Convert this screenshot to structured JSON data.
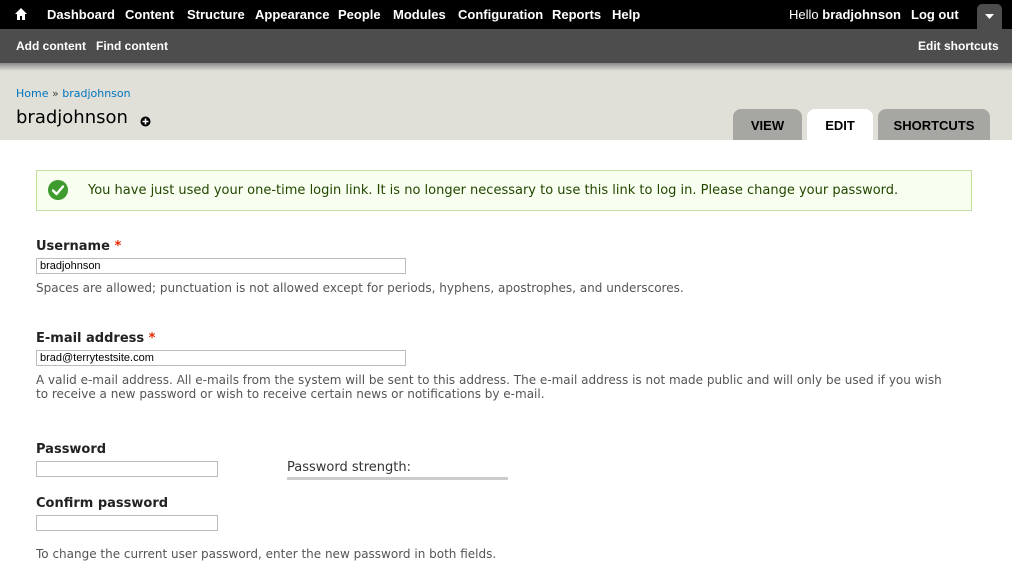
{
  "toolbar": {
    "items": [
      "Dashboard",
      "Content",
      "Structure",
      "Appearance",
      "People",
      "Modules",
      "Configuration",
      "Reports",
      "Help"
    ],
    "hello_prefix": "Hello",
    "username": "bradjohnson",
    "logout": "Log out"
  },
  "shortcuts": {
    "items": [
      "Add content",
      "Find content"
    ],
    "edit": "Edit shortcuts"
  },
  "breadcrumb": {
    "home": "Home",
    "separator": "»",
    "current": "bradjohnson"
  },
  "page_title": "bradjohnson",
  "tabs": [
    "VIEW",
    "EDIT",
    "SHORTCUTS"
  ],
  "active_tab": "EDIT",
  "message": "You have just used your one-time login link. It is no longer necessary to use this link to log in. Please change your password.",
  "form": {
    "username": {
      "label": "Username",
      "required_mark": "*",
      "value": "bradjohnson",
      "description": "Spaces are allowed; punctuation is not allowed except for periods, hyphens, apostrophes, and underscores."
    },
    "email": {
      "label": "E-mail address",
      "required_mark": "*",
      "value": "brad@terrytestsite.com",
      "description": "A valid e-mail address. All e-mails from the system will be sent to this address. The e-mail address is not made public and will only be used if you wish to receive a new password or wish to receive certain news or notifications by e-mail."
    },
    "password": {
      "label": "Password",
      "value": ""
    },
    "password_strength": {
      "label": "Password strength:"
    },
    "confirm_password": {
      "label": "Confirm password",
      "value": ""
    },
    "password_help": "To change the current user password, enter the new password in both fields."
  },
  "colors": {
    "toolbar_bg": "#000000",
    "shortcuts_bg": "#4d4d4d",
    "header_bg": "#e0e0d8",
    "link": "#0074bd",
    "message_bg": "#f8fff0",
    "message_border": "#c4e0a0",
    "success_icon": "#3e9b2e",
    "required": "#e32700"
  },
  "icons": {
    "home": "home-icon",
    "drawer": "chevron-down-icon",
    "shortcut": "plus-circle-icon",
    "status": "check-circle-icon"
  }
}
